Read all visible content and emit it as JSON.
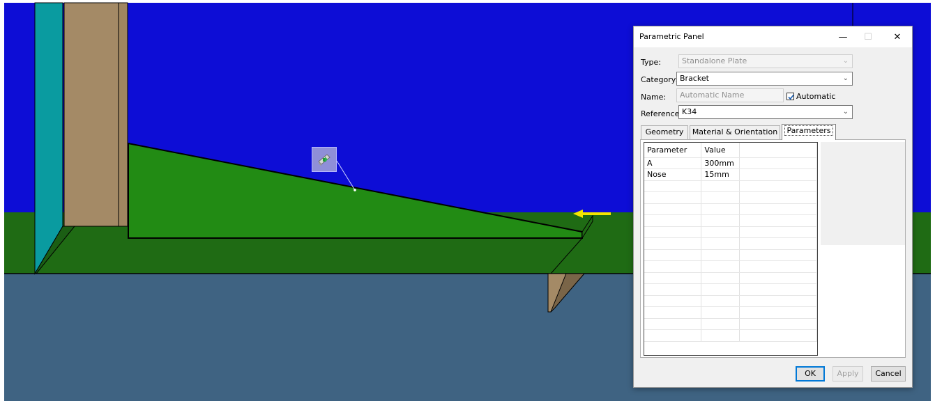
{
  "dialog": {
    "title": "Parametric Panel",
    "window_buttons": {
      "minimize": "—",
      "maximize": "☐",
      "close": "✕"
    },
    "type_label": "Type:",
    "type_value": "Standalone Plate",
    "category_label": "Category:",
    "category_value": "Bracket",
    "name_label": "Name:",
    "name_value": "Automatic Name",
    "automatic_label": "Automatic",
    "automatic_checked": true,
    "reference_label": "Reference:",
    "reference_value": "K34",
    "tabs": [
      {
        "label": "Geometry",
        "active": false
      },
      {
        "label": "Material & Orientation",
        "active": false
      },
      {
        "label": "Parameters",
        "active": true
      }
    ],
    "table": {
      "headers": [
        "Parameter",
        "Value",
        ""
      ],
      "rows": [
        [
          "A",
          "300mm",
          ""
        ],
        [
          "Nose",
          "15mm",
          ""
        ]
      ]
    },
    "buttons": {
      "ok": "OK",
      "apply": "Apply",
      "cancel": "Cancel"
    }
  },
  "viewport": {
    "colors": {
      "background_sky": "#0d0dd6",
      "floor_green": "#1f6b14",
      "plate_green": "#228b14",
      "lower_area": "#3f6382",
      "wall_teal": "#0a9ba0",
      "column_tan": "#a48a66",
      "marker_yellow": "#f3e600",
      "handle_icon_bg": "#8f8fd8"
    },
    "icons": [
      "plate-handle-icon",
      "direction-arrow-icon"
    ]
  }
}
